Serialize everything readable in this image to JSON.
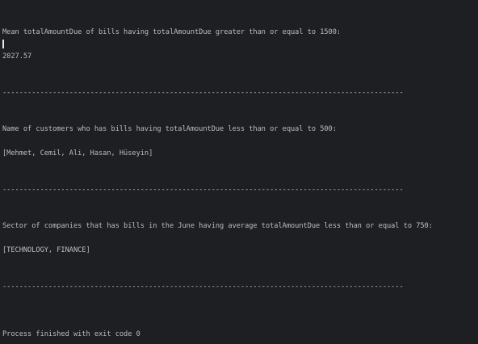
{
  "console": {
    "q1_label": "Mean totalAmountDue of bills having totalAmountDue greater than or equal to 1500:",
    "q1_result": "2027.57",
    "separator": "------------------------------------------------------------------------------------------------",
    "q2_label": "Name of customers who has bills having totalAmountDue less than or equal to 500:",
    "q2_result": "[Mehmet, Cemil, Ali, Hasan, Hüseyin]",
    "q3_label": "Sector of companies that has bills in the June having average totalAmountDue less than or equal to 750:",
    "q3_result": "[TECHNOLOGY, FINANCE]",
    "exit_message": "Process finished with exit code 0"
  }
}
